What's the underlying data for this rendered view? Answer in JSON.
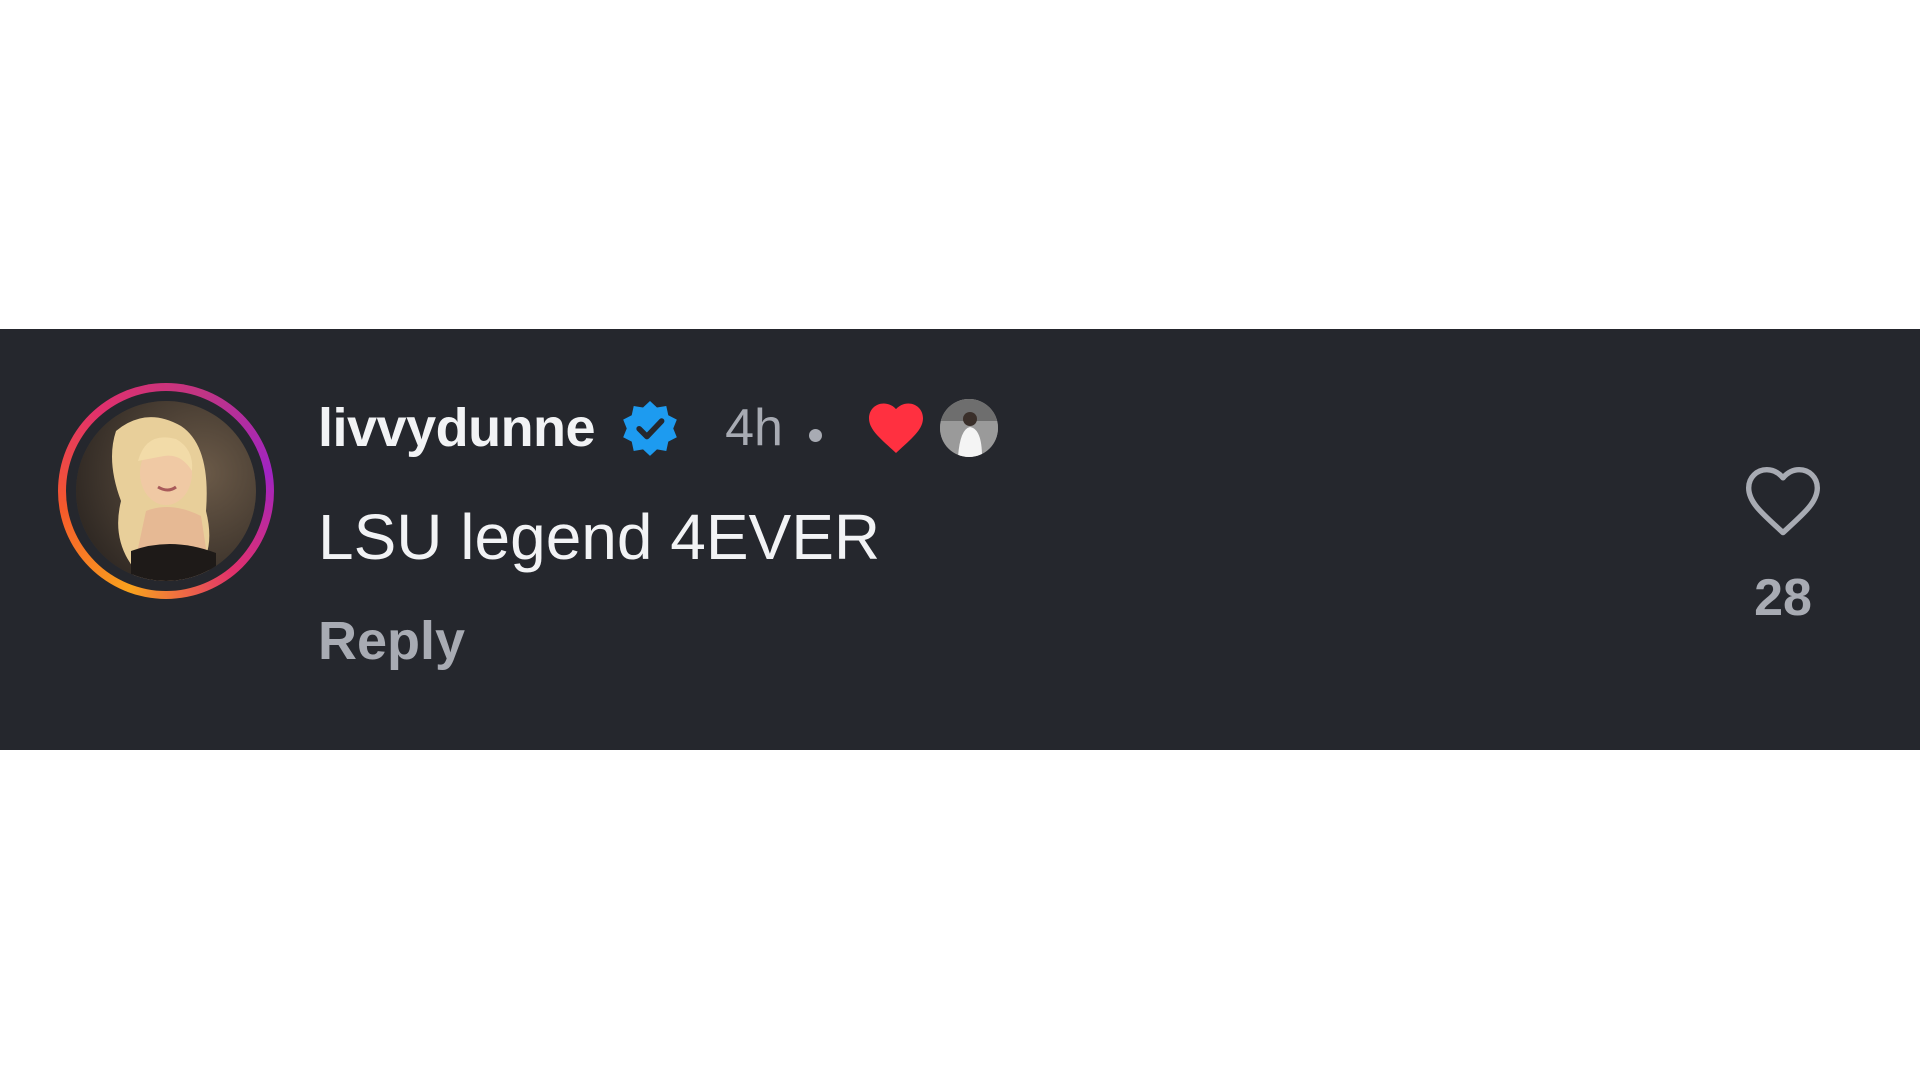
{
  "comment": {
    "username": "livvydunne",
    "verified": true,
    "timestamp": "4h",
    "text": "LSU legend 4EVER",
    "reply_label": "Reply",
    "like_count": "28",
    "liked_by_author": true
  },
  "colors": {
    "strip_background": "#25272d",
    "page_background": "#ffffff",
    "primary_text": "#f2f3f5",
    "secondary_text": "#a8abb3",
    "verified_blue": "#1d9bf0",
    "heart_red": "#ff3040"
  },
  "icons": {
    "verified": "verified-badge-icon",
    "liked_by_creator": "heart-filled-icon",
    "like": "heart-outline-icon"
  }
}
